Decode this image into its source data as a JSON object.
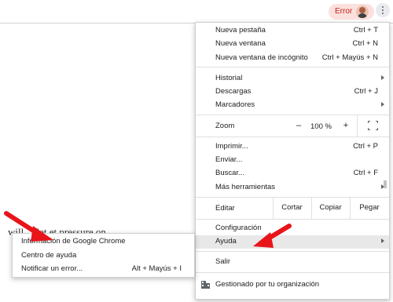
{
  "toolbar": {
    "error_label": "Error"
  },
  "background_text": "will ... let et pressure on",
  "menu": {
    "new_tab": {
      "label": "Nueva pestaña",
      "shortcut": "Ctrl + T"
    },
    "new_window": {
      "label": "Nueva ventana",
      "shortcut": "Ctrl + N"
    },
    "incognito": {
      "label": "Nueva ventana de incógnito",
      "shortcut": "Ctrl + Mayús + N"
    },
    "history": {
      "label": "Historial"
    },
    "downloads": {
      "label": "Descargas",
      "shortcut": "Ctrl + J"
    },
    "bookmarks": {
      "label": "Marcadores"
    },
    "zoom": {
      "label": "Zoom",
      "minus": "–",
      "level": "100 %",
      "plus": "+"
    },
    "print": {
      "label": "Imprimir...",
      "shortcut": "Ctrl + P"
    },
    "cast": {
      "label": "Enviar..."
    },
    "find": {
      "label": "Buscar...",
      "shortcut": "Ctrl + F"
    },
    "more_tools": {
      "label": "Más herramientas"
    },
    "edit": {
      "label": "Editar",
      "cut": "Cortar",
      "copy": "Copiar",
      "paste": "Pegar"
    },
    "settings": {
      "label": "Configuración"
    },
    "help": {
      "label": "Ayuda"
    },
    "exit": {
      "label": "Salir"
    },
    "managed": {
      "label": "Gestionado por tu organización"
    }
  },
  "help_submenu": {
    "about": {
      "label": "Información de Google Chrome"
    },
    "help_center": {
      "label": "Centro de ayuda"
    },
    "report": {
      "label": "Notificar un error...",
      "shortcut": "Alt + Mayús + I"
    }
  },
  "colors": {
    "annotation_arrow": "#e8141a",
    "highlight": "#e8e8e8",
    "error_chip_bg": "#fbe0dd",
    "error_text": "#c5221f"
  }
}
